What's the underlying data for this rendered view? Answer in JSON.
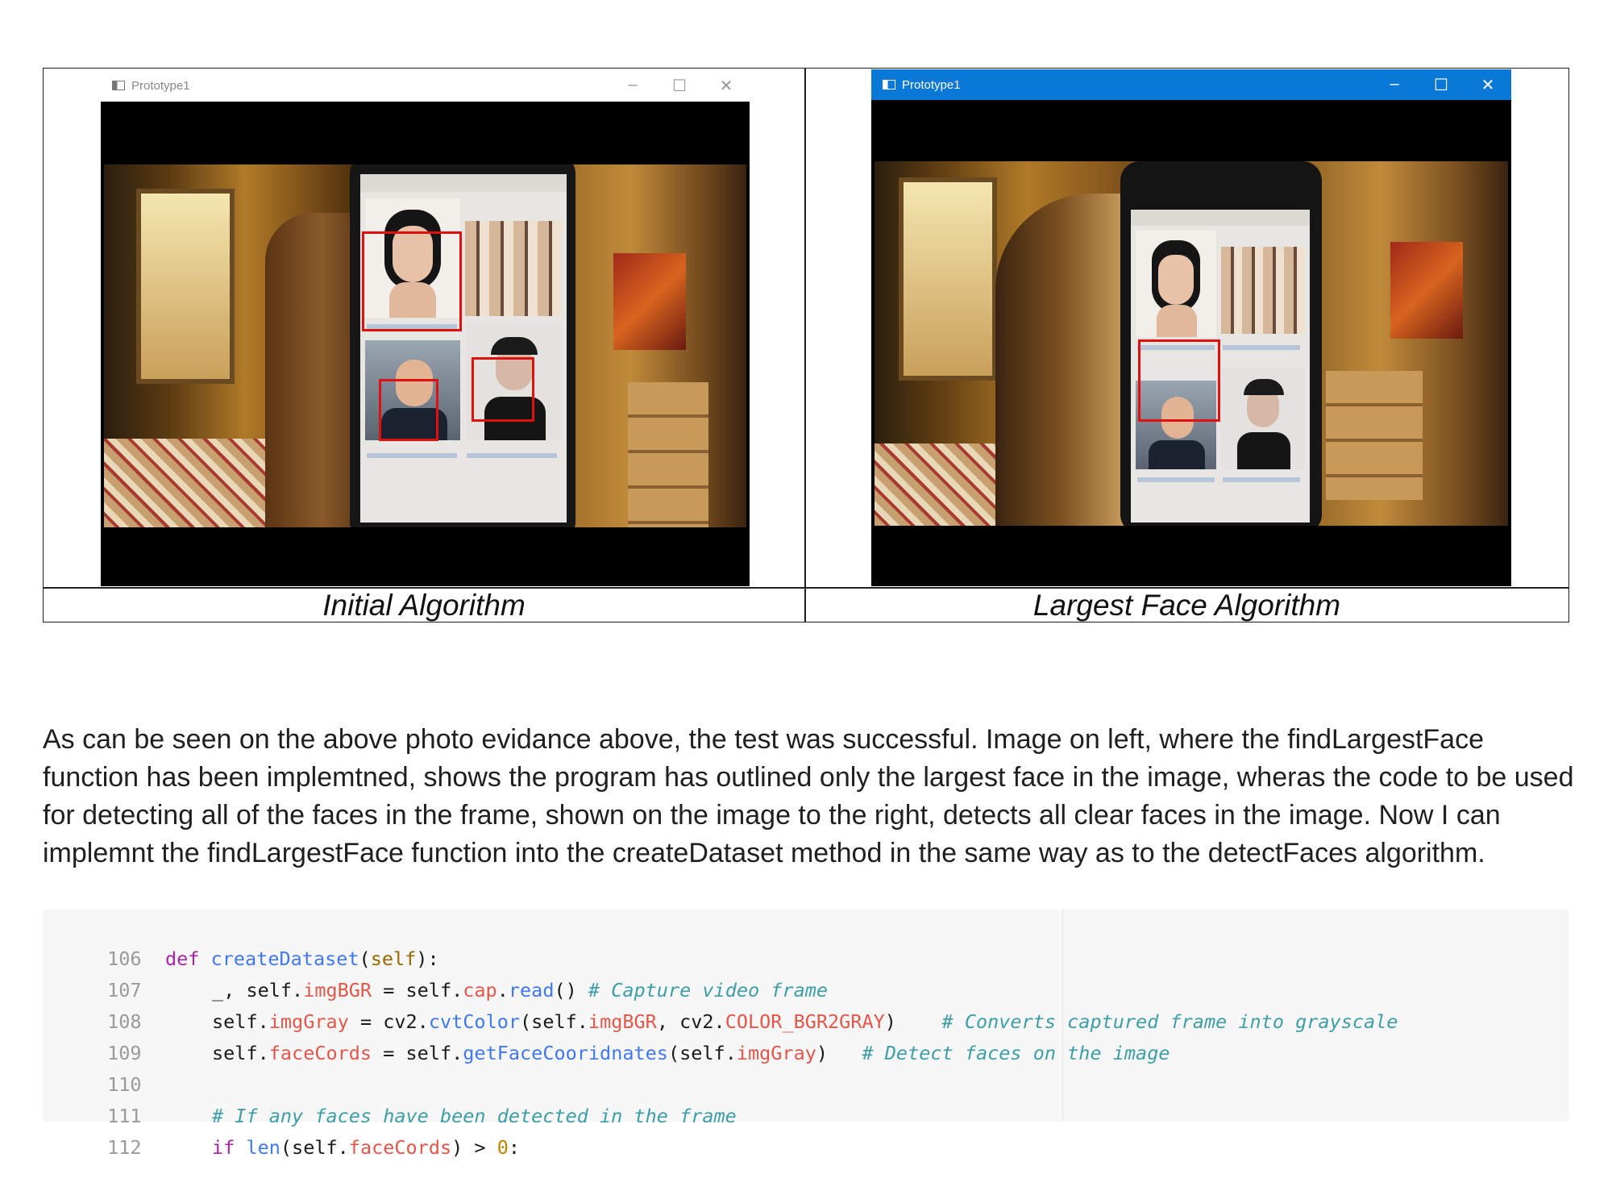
{
  "figure": {
    "left_window": {
      "title": "Prototype1",
      "controls": [
        "–",
        "☐",
        "✕"
      ]
    },
    "right_window": {
      "title": "Prototype1",
      "controls": [
        "–",
        "☐",
        "✕"
      ]
    },
    "captions": [
      "Initial Algorithm",
      "Largest Face Algorithm"
    ]
  },
  "paragraph": "As can be seen on the above photo evidance above, the test was successful. Image on left, where the findLargestFace function has been implemtned, shows the program has outlined only the largest face in the image, wheras the code to be used for detecting all of the faces in the frame, shown on the image to the right, detects all clear faces in the image. Now I can implemnt the findLargestFace function into the createDataset method in the same way as to the detectFaces algorithm.",
  "code": {
    "line_numbers": [
      "106",
      "107",
      "108",
      "109",
      "110",
      "111",
      "112"
    ],
    "l106": {
      "kw": "def",
      "name": "createDataset",
      "p1": "(",
      "self": "self",
      "p2": "):"
    },
    "l107": {
      "a": "_, self.",
      "attr1": "imgBGR",
      "b": " = self.",
      "attr2": "cap",
      "c": ".",
      "fn": "read",
      "d": "() ",
      "cmt": "# Capture video frame"
    },
    "l108": {
      "a": "self.",
      "attr1": "imgGray",
      "b": " = cv2.",
      "fn": "cvtColor",
      "c": "(self.",
      "attr2": "imgBGR",
      "d": ", cv2.",
      "attr3": "COLOR_BGR2GRAY",
      "e": ")    ",
      "cmt": "# Converts captured frame into grayscale"
    },
    "l109": {
      "a": "self.",
      "attr1": "faceCords",
      "b": " = self.",
      "fn": "getFaceCooridnates",
      "c": "(self.",
      "attr2": "imgGray",
      "d": ")   ",
      "cmt": "# Detect faces on the image"
    },
    "l111": {
      "cmt": "# If any faces have been detected in the frame"
    },
    "l112": {
      "kw": "if",
      "sp": " ",
      "fn": "len",
      "a": "(self.",
      "attr": "faceCords",
      "b": ") > ",
      "num": "0",
      "c": ":"
    }
  }
}
